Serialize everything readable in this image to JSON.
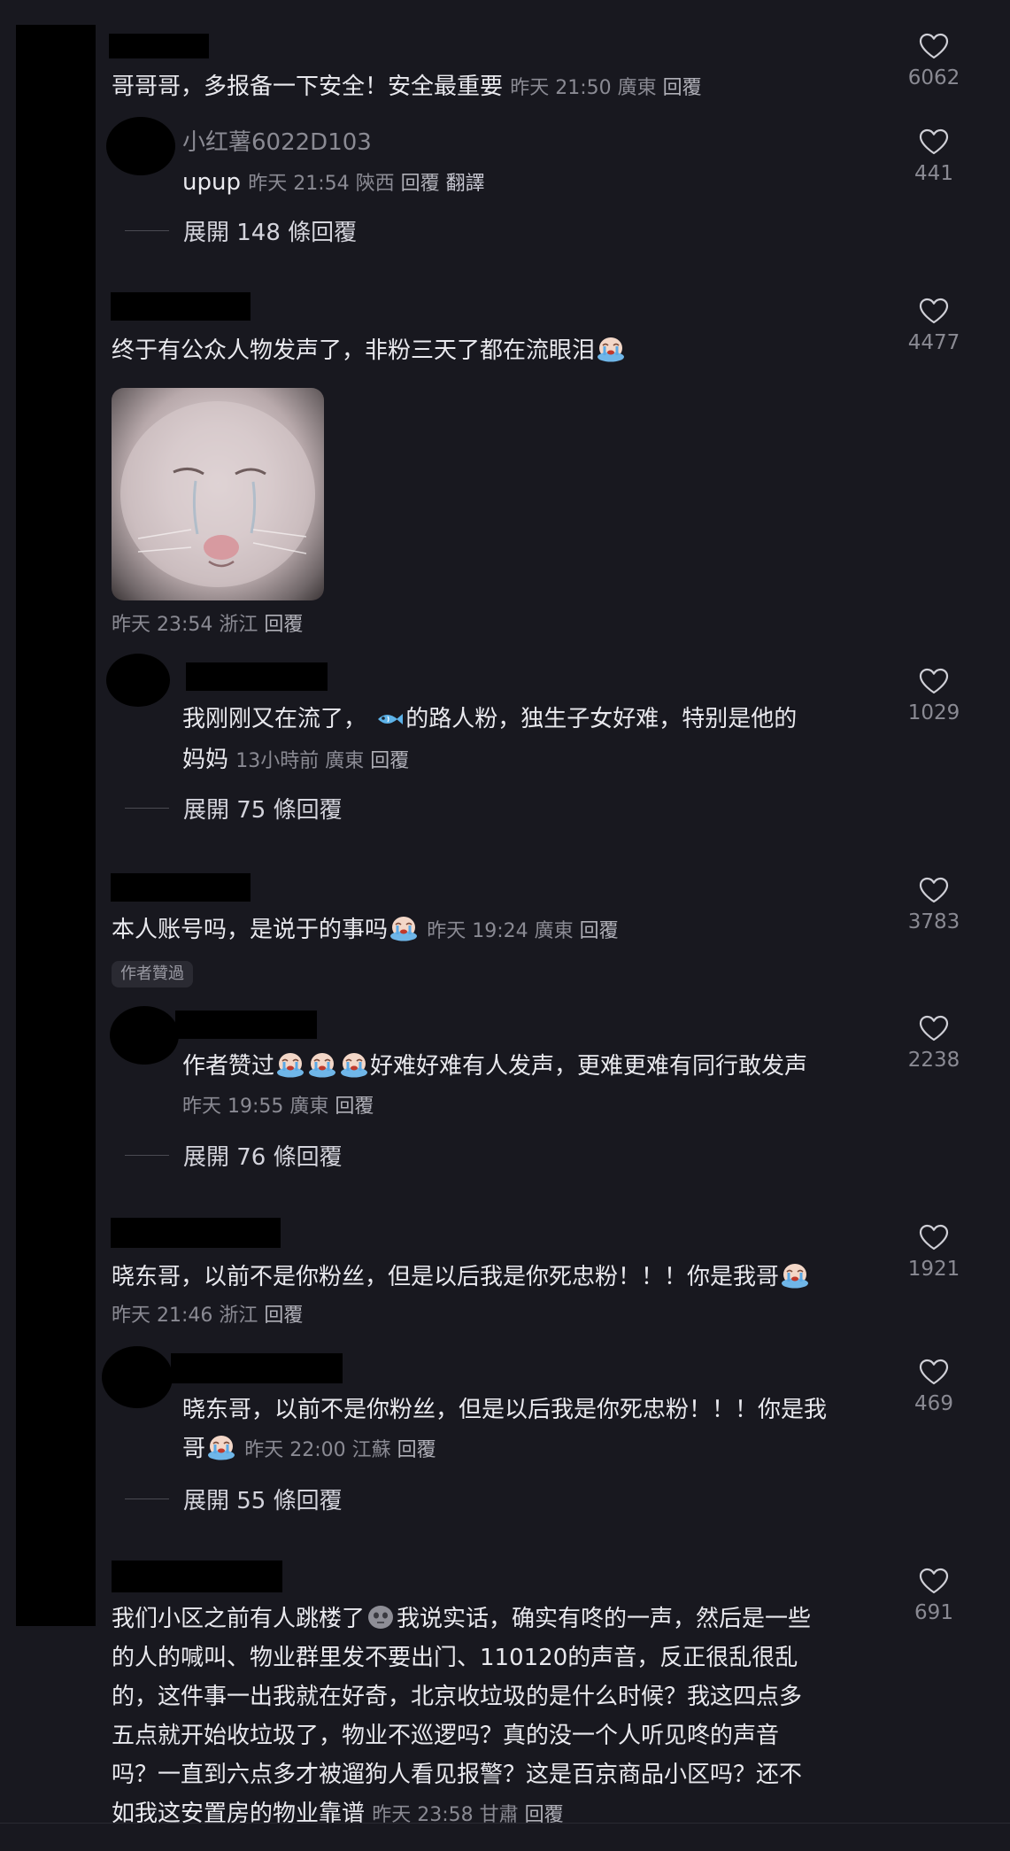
{
  "comments": [
    {
      "text": "哥哥哥，多报备一下安全！安全最重要",
      "meta": "昨天 21:50 廣東",
      "reply": "回覆",
      "likes": "6062",
      "replies": [
        {
          "username": "小红薯6022D103",
          "text": "upup",
          "meta": "昨天 21:54 陝西",
          "reply": "回覆",
          "translate": "翻譯",
          "likes": "441",
          "expand": "展開 148 條回覆"
        }
      ]
    },
    {
      "text": "终于有公众人物发声了，非粉三天了都在流眼泪",
      "meta": "昨天 23:54 浙江",
      "reply": "回覆",
      "likes": "4477",
      "replies": [
        {
          "text_part1": "我刚刚又在流了，",
          "text_part2": "的路人粉，独生子女好难，特别是他的",
          "text_part3": "妈妈",
          "meta": "13小時前 廣東",
          "reply": "回覆",
          "likes": "1029",
          "expand": "展開 75 條回覆"
        }
      ]
    },
    {
      "text": "本人账号吗，是说于的事吗",
      "meta": "昨天 19:24 廣東",
      "reply": "回覆",
      "badge": "作者贊過",
      "likes": "3783",
      "replies": [
        {
          "text_part1": "作者赞过",
          "text_part2": "好难好难有人发声，更难更难有同行敢发声",
          "meta": "昨天 19:55 廣東",
          "reply": "回覆",
          "likes": "2238",
          "expand": "展開 76 條回覆"
        }
      ]
    },
    {
      "text": "晓东哥，以前不是你粉丝，但是以后我是你死忠粉！！！你是我哥",
      "meta": "昨天 21:46 浙江",
      "reply": "回覆",
      "likes": "1921",
      "replies": [
        {
          "text_line1": "晓东哥，以前不是你粉丝，但是以后我是你死忠粉！！！你是我",
          "text_line2": "哥",
          "meta": "昨天 22:00 江蘇",
          "reply": "回覆",
          "likes": "469",
          "expand": "展開 55 條回覆"
        }
      ]
    },
    {
      "line1_a": "我们小区之前有人跳楼了",
      "line1_b": "我说实话，确实有咚的一声，然后是一些",
      "line2": "的人的喊叫、物业群里发不要出门、110120的声音，反正很乱很乱",
      "line3": "的，这件事一出我就在好奇，北京收垃圾的是什么时候？我这四点多",
      "line4": "五点就开始收垃圾了，物业不巡逻吗？真的没一个人听见咚的声音",
      "line5": "吗？一直到六点多才被遛狗人看见报警？这是百京商品小区吗？还不",
      "line6": "如我这安置房的物业靠谱",
      "meta": "昨天 23:58 甘肅",
      "reply": "回覆",
      "likes": "691"
    }
  ],
  "icons": {
    "like": "heart-outline-icon",
    "crying": "crying-face-emoji",
    "fish": "fish-emoji",
    "skull": "skull-emoji"
  },
  "colors": {
    "background": "#18181f",
    "text": "#e9e9ee",
    "meta": "#8a8a93"
  }
}
